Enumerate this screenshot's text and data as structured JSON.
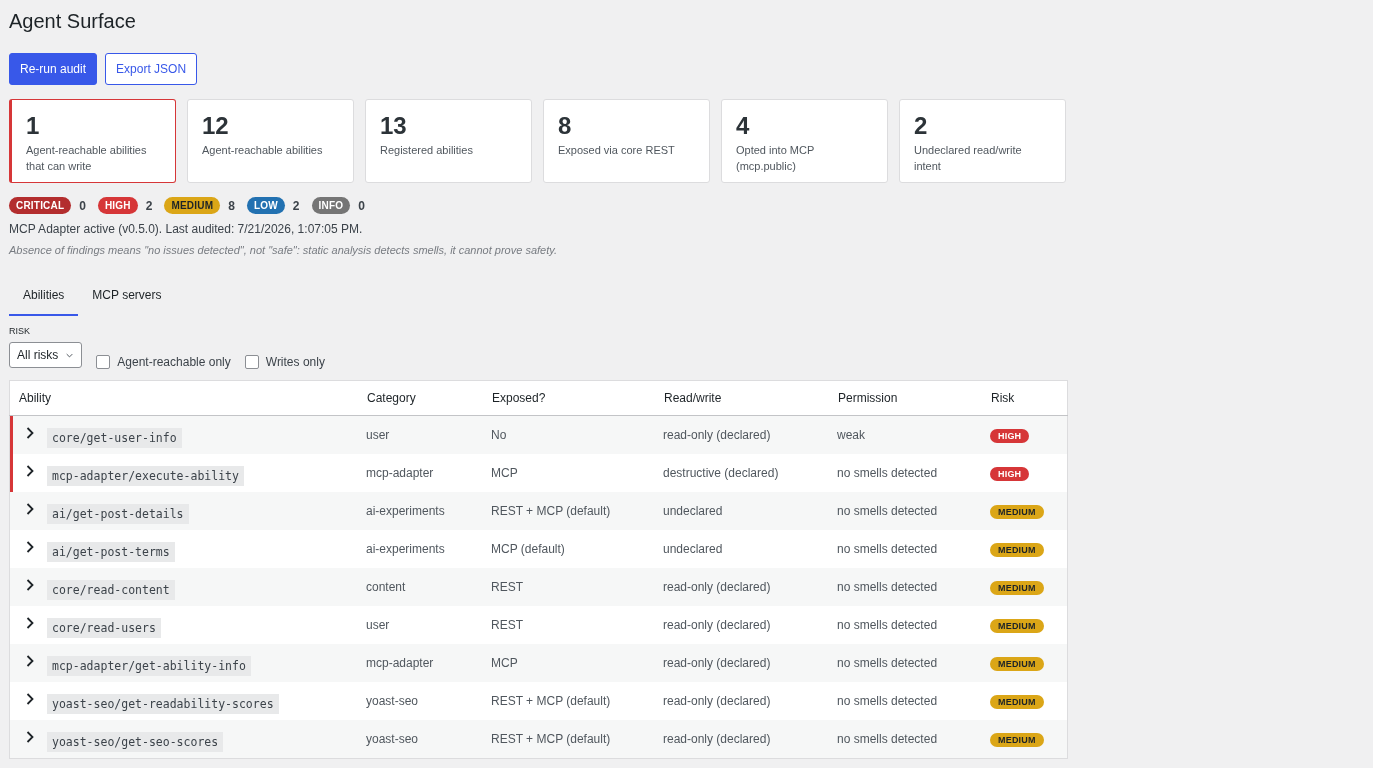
{
  "title": "Agent Surface",
  "buttons": [
    {
      "label": "Re-run audit",
      "kind": "primary"
    },
    {
      "label": "Export JSON",
      "kind": "secondary"
    }
  ],
  "cards": [
    {
      "value": "1",
      "label": "Agent-reachable abilities that can write",
      "highlighted": true
    },
    {
      "value": "12",
      "label": "Agent-reachable abilities",
      "highlighted": false
    },
    {
      "value": "13",
      "label": "Registered abilities",
      "highlighted": false
    },
    {
      "value": "8",
      "label": "Exposed via core REST",
      "highlighted": false
    },
    {
      "value": "4",
      "label": "Opted into MCP (mcp.public)",
      "highlighted": false
    },
    {
      "value": "2",
      "label": "Undeclared read/write intent",
      "highlighted": false
    }
  ],
  "risk_counts": [
    {
      "label": "CRITICAL",
      "count": "0",
      "color": "#b32d2e"
    },
    {
      "label": "HIGH",
      "count": "2",
      "color": "#d63638"
    },
    {
      "label": "MEDIUM",
      "count": "8",
      "color": "#dba617"
    },
    {
      "label": "LOW",
      "count": "2",
      "color": "#2271b1"
    },
    {
      "label": "INFO",
      "count": "0",
      "color": "#757575"
    }
  ],
  "status": "MCP Adapter active (v0.5.0). Last audited: 7/21/2026, 1:07:05 PM.",
  "disclaimer": "Absence of findings means \"no issues detected\", not \"safe\": static analysis detects smells, it cannot prove safety.",
  "tabs": [
    {
      "label": "Abilities",
      "selected": true
    },
    {
      "label": "MCP servers",
      "selected": false
    }
  ],
  "filters": {
    "risk_label": "RISK",
    "risk_select": "All risks",
    "checkboxes": [
      {
        "label": "Agent-reachable only",
        "checked": false
      },
      {
        "label": "Writes only",
        "checked": false
      }
    ]
  },
  "table": {
    "columns": [
      "Ability",
      "Category",
      "Exposed?",
      "Read/write",
      "Permission",
      "Risk"
    ],
    "rows": [
      {
        "ability": "core/get-user-info",
        "category": "user",
        "exposed": "No",
        "read_write": "read-only (declared)",
        "permission": "weak",
        "risk": {
          "label": "HIGH",
          "color": "#d63638"
        },
        "flagged": true
      },
      {
        "ability": "mcp-adapter/execute-ability",
        "category": "mcp-adapter",
        "exposed": "MCP",
        "read_write": "destructive (declared)",
        "permission": "no smells detected",
        "risk": {
          "label": "HIGH",
          "color": "#d63638"
        },
        "flagged": true
      },
      {
        "ability": "ai/get-post-details",
        "category": "ai-experiments",
        "exposed": "REST + MCP (default)",
        "read_write": "undeclared",
        "permission": "no smells detected",
        "risk": {
          "label": "MEDIUM",
          "color": "#dba617"
        },
        "flagged": false
      },
      {
        "ability": "ai/get-post-terms",
        "category": "ai-experiments",
        "exposed": "MCP (default)",
        "read_write": "undeclared",
        "permission": "no smells detected",
        "risk": {
          "label": "MEDIUM",
          "color": "#dba617"
        },
        "flagged": false
      },
      {
        "ability": "core/read-content",
        "category": "content",
        "exposed": "REST",
        "read_write": "read-only (declared)",
        "permission": "no smells detected",
        "risk": {
          "label": "MEDIUM",
          "color": "#dba617"
        },
        "flagged": false
      },
      {
        "ability": "core/read-users",
        "category": "user",
        "exposed": "REST",
        "read_write": "read-only (declared)",
        "permission": "no smells detected",
        "risk": {
          "label": "MEDIUM",
          "color": "#dba617"
        },
        "flagged": false
      },
      {
        "ability": "mcp-adapter/get-ability-info",
        "category": "mcp-adapter",
        "exposed": "MCP",
        "read_write": "read-only (declared)",
        "permission": "no smells detected",
        "risk": {
          "label": "MEDIUM",
          "color": "#dba617"
        },
        "flagged": false
      },
      {
        "ability": "yoast-seo/get-readability-scores",
        "category": "yoast-seo",
        "exposed": "REST + MCP (default)",
        "read_write": "read-only (declared)",
        "permission": "no smells detected",
        "risk": {
          "label": "MEDIUM",
          "color": "#dba617"
        },
        "flagged": false
      },
      {
        "ability": "yoast-seo/get-seo-scores",
        "category": "yoast-seo",
        "exposed": "REST + MCP (default)",
        "read_write": "read-only (declared)",
        "permission": "no smells detected",
        "risk": {
          "label": "MEDIUM",
          "color": "#dba617"
        },
        "flagged": false
      }
    ]
  }
}
